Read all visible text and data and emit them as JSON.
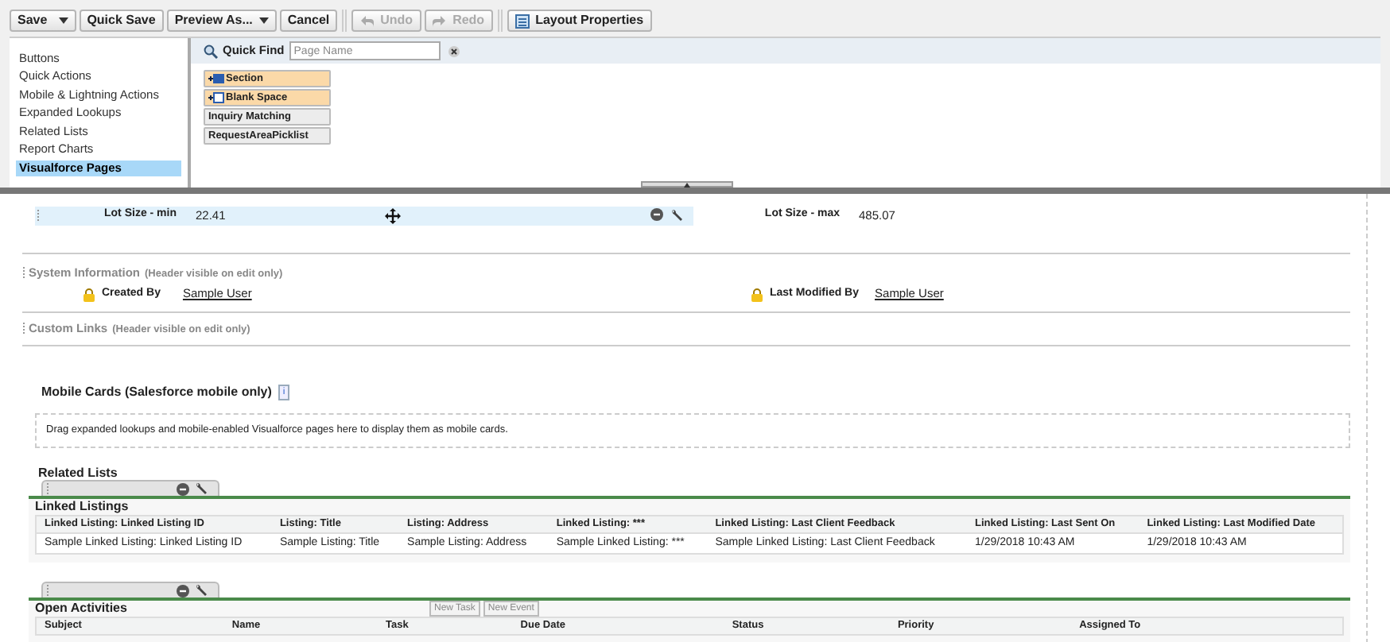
{
  "toolbar": [
    {
      "label": "Save",
      "kind": "split",
      "disabled": false
    },
    {
      "label": "Quick Save",
      "kind": "button",
      "disabled": false
    },
    {
      "label": "Preview As...",
      "kind": "dropdown",
      "disabled": false
    },
    {
      "label": "Cancel",
      "kind": "button",
      "disabled": false
    },
    {
      "label": "Undo",
      "kind": "undo",
      "disabled": true
    },
    {
      "label": "Redo",
      "kind": "redo",
      "disabled": true
    },
    {
      "label": "Layout Properties",
      "kind": "properties",
      "disabled": false
    }
  ],
  "palette": {
    "categories": [
      {
        "label": "Buttons",
        "selected": false
      },
      {
        "label": "Quick Actions",
        "selected": false
      },
      {
        "label": "Mobile & Lightning Actions",
        "selected": false
      },
      {
        "label": "Expanded Lookups",
        "selected": false
      },
      {
        "label": "Related Lists",
        "selected": false
      },
      {
        "label": "Report Charts",
        "selected": false
      },
      {
        "label": "Visualforce Pages",
        "selected": true
      }
    ],
    "quick_find": {
      "label": "Quick Find",
      "placeholder": "Page Name"
    },
    "items": [
      {
        "label": "Section",
        "kind": "section"
      },
      {
        "label": "Blank Space",
        "kind": "blank"
      },
      {
        "label": "Inquiry Matching",
        "kind": "page"
      },
      {
        "label": "RequestAreaPicklist",
        "kind": "page"
      }
    ]
  },
  "fields": [
    {
      "label": "Lot Size - min",
      "value": "22.41",
      "selected": true
    },
    {
      "label": "Lot Size - max",
      "value": "485.07",
      "selected": false
    }
  ],
  "sections": [
    {
      "title": "System Information",
      "note": "(Header visible on edit only)",
      "fields": [
        {
          "label": "Created By",
          "value": "Sample User"
        },
        {
          "label": "Last Modified By",
          "value": "Sample User"
        }
      ]
    },
    {
      "title": "Custom Links",
      "note": "(Header visible on edit only)"
    }
  ],
  "mobile_cards": {
    "title": "Mobile Cards (Salesforce mobile only)",
    "info": "i",
    "hint": "Drag expanded lookups and mobile-enabled Visualforce pages here to display them as mobile cards."
  },
  "related_lists": {
    "title": "Related Lists",
    "lists": [
      {
        "title": "Linked Listings",
        "columns": [
          "Linked Listing: Linked Listing ID",
          "Listing: Title",
          "Listing: Address",
          "Linked Listing: ***",
          "Linked Listing: Last Client Feedback",
          "Linked Listing: Last Sent On",
          "Linked Listing: Last Modified Date"
        ],
        "rows": [
          [
            "Sample Linked Listing: Linked Listing ID",
            "Sample Listing: Title",
            "Sample Listing: Address",
            "Sample Linked Listing: ***",
            "Sample Linked Listing: Last Client Feedback",
            "1/29/2018 10:43 AM",
            "1/29/2018 10:43 AM"
          ]
        ]
      },
      {
        "title": "Open Activities",
        "buttons": [
          "New Task",
          "New Event"
        ],
        "columns": [
          "Subject",
          "Name",
          "Task",
          "Due Date",
          "Status",
          "Priority",
          "Assigned To"
        ]
      }
    ]
  }
}
